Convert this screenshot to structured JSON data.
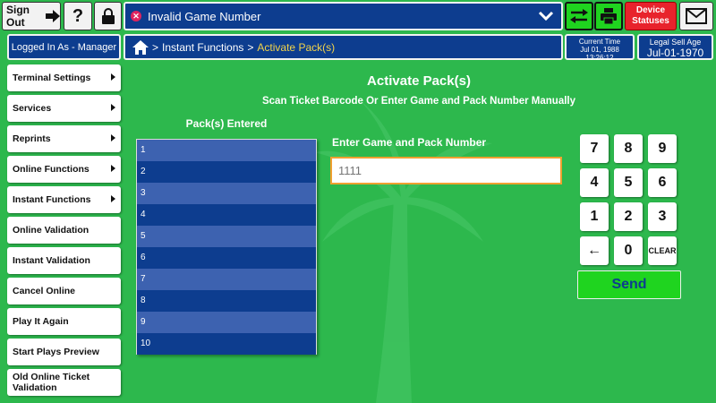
{
  "header": {
    "sign_out": "Sign Out",
    "help": "?",
    "status_message": "Invalid Game Number",
    "device_statuses": "Device Statuses",
    "logged_in": "Logged In As - Manager",
    "current_time_label": "Current Time",
    "current_date": "Jul 01, 1988",
    "current_time": "13:26:12",
    "legal_age_label": "Legal Sell Age",
    "legal_age_date": "Jul-01-1970"
  },
  "breadcrumb": {
    "section": "Instant Functions",
    "current": "Activate Pack(s)",
    "separator": ">"
  },
  "sidebar": {
    "items": [
      {
        "label": "Terminal Settings",
        "arrow": true
      },
      {
        "label": "Services",
        "arrow": true
      },
      {
        "label": "Reprints",
        "arrow": true
      },
      {
        "label": "Online Functions",
        "arrow": true
      },
      {
        "label": "Instant Functions",
        "arrow": true
      },
      {
        "label": "Online Validation",
        "arrow": false
      },
      {
        "label": "Instant Validation",
        "arrow": false
      },
      {
        "label": "Cancel Online",
        "arrow": false
      },
      {
        "label": "Play It Again",
        "arrow": false
      },
      {
        "label": "Start Plays Preview",
        "arrow": false
      },
      {
        "label": "Old Online Ticket Validation",
        "arrow": false
      }
    ]
  },
  "main": {
    "title": "Activate Pack(s)",
    "subtitle": "Scan Ticket Barcode Or Enter Game and Pack Number Manually",
    "packs_heading": "Pack(s) Entered",
    "packs": [
      "1",
      "2",
      "3",
      "4",
      "5",
      "6",
      "7",
      "8",
      "9",
      "10"
    ],
    "input_label": "Enter Game and Pack Number",
    "input_placeholder": "1111"
  },
  "keypad": {
    "keys": [
      "7",
      "8",
      "9",
      "4",
      "5",
      "6",
      "1",
      "2",
      "3",
      "←",
      "0",
      "CLEAR"
    ],
    "send": "Send"
  },
  "colors": {
    "background": "#2db84d",
    "navy": "#0d3d8f",
    "bright_green": "#1fd41f",
    "alert_red": "#e8232c",
    "highlight": "#f2d34a"
  }
}
